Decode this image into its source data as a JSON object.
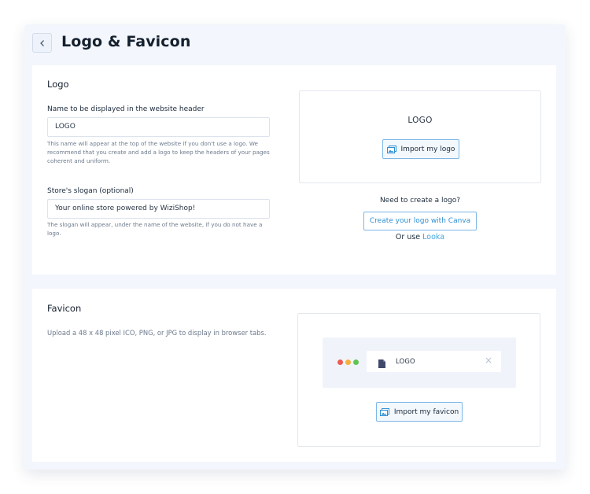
{
  "header": {
    "title": "Logo & Favicon",
    "back_icon": "chevron-left-icon"
  },
  "logo_section": {
    "title": "Logo",
    "name_field": {
      "label": "Name to be displayed in the website header",
      "value": "LOGO",
      "help_lines": [
        "This name will appear at the top of the website if you don't use a logo. We",
        "recommend that you create and add a logo to keep the headers of your pages",
        "coherent and uniform."
      ]
    },
    "slogan_field": {
      "label": "Store's slogan (optional)",
      "value": "Your online store powered by WiziShop!",
      "help_lines": [
        "The slogan will appear, under the name of the website, if you do not have a",
        "logo."
      ]
    },
    "preview": {
      "logo_text": "LOGO",
      "import_button": "Import my logo",
      "import_icon": "image-icon"
    },
    "create": {
      "prompt": "Need to create a logo?",
      "canva_button": "Create your logo with Canva",
      "or_use": "Or use",
      "looka_link": "Looka"
    }
  },
  "favicon_section": {
    "title": "Favicon",
    "description": "Upload a 48 x 48 pixel ICO, PNG, or JPG to display in browser tabs.",
    "preview": {
      "tab_label": "LOGO",
      "tab_icon": "file-icon",
      "close_icon": "close-icon",
      "close_glyph": "×",
      "window_dot_colors": [
        "#ee5b50",
        "#f4b13e",
        "#5fc453"
      ]
    },
    "import_button": "Import my favicon",
    "import_icon": "image-icon"
  },
  "colors": {
    "accent": "#2e8fd2",
    "link": "#43a5e0",
    "border_accent": "#7db7e6"
  }
}
